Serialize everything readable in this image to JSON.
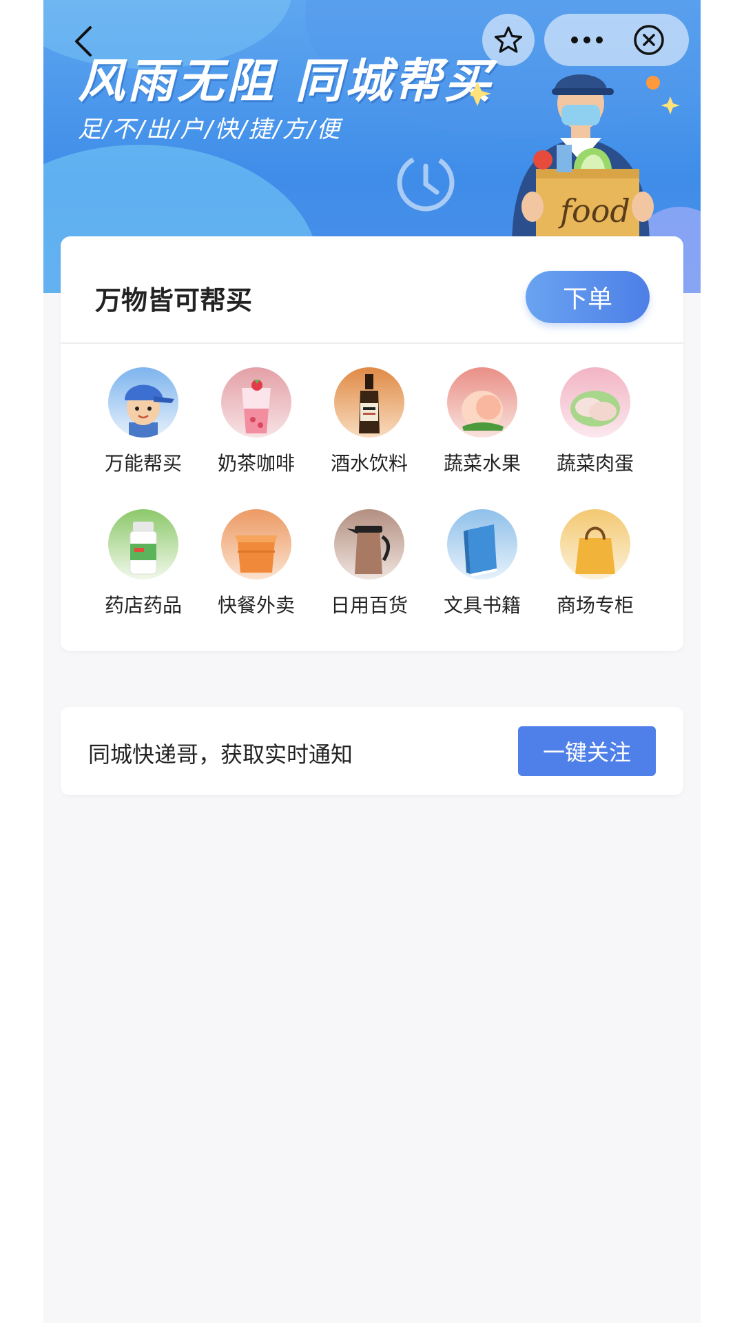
{
  "banner": {
    "title": "风雨无阻  同城帮买",
    "subtitle": "足/不/出/户/快/捷/方/便",
    "food_text": "food"
  },
  "nav": {
    "back_icon": "chevron-left-icon",
    "favorite_icon": "star-icon",
    "more_icon": "more-icon",
    "close_icon": "close-circle-icon"
  },
  "card": {
    "title": "万物皆可帮买",
    "order_button": "下单",
    "categories": [
      {
        "label": "万能帮买",
        "icon": "courier-icon"
      },
      {
        "label": "奶茶咖啡",
        "icon": "milk-tea-icon"
      },
      {
        "label": "酒水饮料",
        "icon": "liquor-bottle-icon"
      },
      {
        "label": "蔬菜水果",
        "icon": "peach-icon"
      },
      {
        "label": "蔬菜肉蛋",
        "icon": "meat-icon"
      },
      {
        "label": "药店药品",
        "icon": "medicine-bottle-icon"
      },
      {
        "label": "快餐外卖",
        "icon": "takeout-box-icon"
      },
      {
        "label": "日用百货",
        "icon": "kettle-icon"
      },
      {
        "label": "文具书籍",
        "icon": "book-icon"
      },
      {
        "label": "商场专柜",
        "icon": "shopping-bag-icon"
      }
    ]
  },
  "follow": {
    "text": "同城快递哥，获取实时通知",
    "button": "一键关注"
  },
  "colors": {
    "accent": "#4f7fe8",
    "banner": "#4c8fe9",
    "background": "#f7f7f9"
  }
}
